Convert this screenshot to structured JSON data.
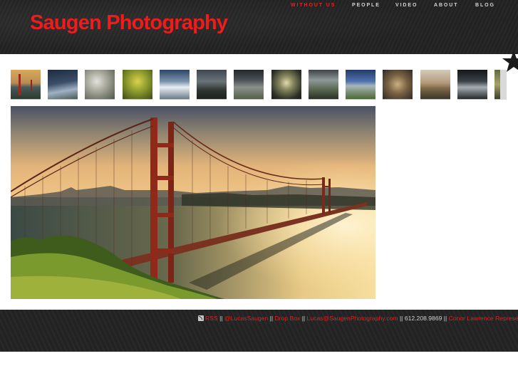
{
  "header": {
    "site_title": "Saugen Photography",
    "nav": [
      {
        "label": "WITHOUT US",
        "active": true
      },
      {
        "label": "PEOPLE",
        "active": false
      },
      {
        "label": "VIDEO",
        "active": false
      },
      {
        "label": "ABOUT",
        "active": false
      },
      {
        "label": "BLOG",
        "active": false
      }
    ]
  },
  "colors": {
    "accent": "#ee1c1c",
    "header_background": "#232323",
    "footer_background": "#242424",
    "nav_text": "#d6d6d6"
  },
  "gallery": {
    "thumbnails": [
      {
        "name": "thumb-golden-gate"
      },
      {
        "name": "thumb-dark-sky"
      },
      {
        "name": "thumb-clouds"
      },
      {
        "name": "thumb-green-tree"
      },
      {
        "name": "thumb-waterfall"
      },
      {
        "name": "thumb-dark-landscape"
      },
      {
        "name": "thumb-gray-field"
      },
      {
        "name": "thumb-flower-plant"
      },
      {
        "name": "thumb-railway"
      },
      {
        "name": "thumb-blue-field"
      },
      {
        "name": "thumb-ruins"
      },
      {
        "name": "thumb-sunset-hills"
      },
      {
        "name": "thumb-dark-interior"
      },
      {
        "name": "thumb-partial"
      }
    ],
    "selected_index": 0,
    "main_image_subject": "Golden Gate Bridge at sunset"
  },
  "footer": {
    "rss_icon": "rss-icon",
    "rss_label": "RSS",
    "separator": "||",
    "twitter_label": "@LucasSaugen",
    "dropbox_label": "Drop Box",
    "email_label": "Lucas@SaugenPhotography.com",
    "phone": "612.208.9869",
    "rep_label": "Conor Lawrence Representation"
  }
}
